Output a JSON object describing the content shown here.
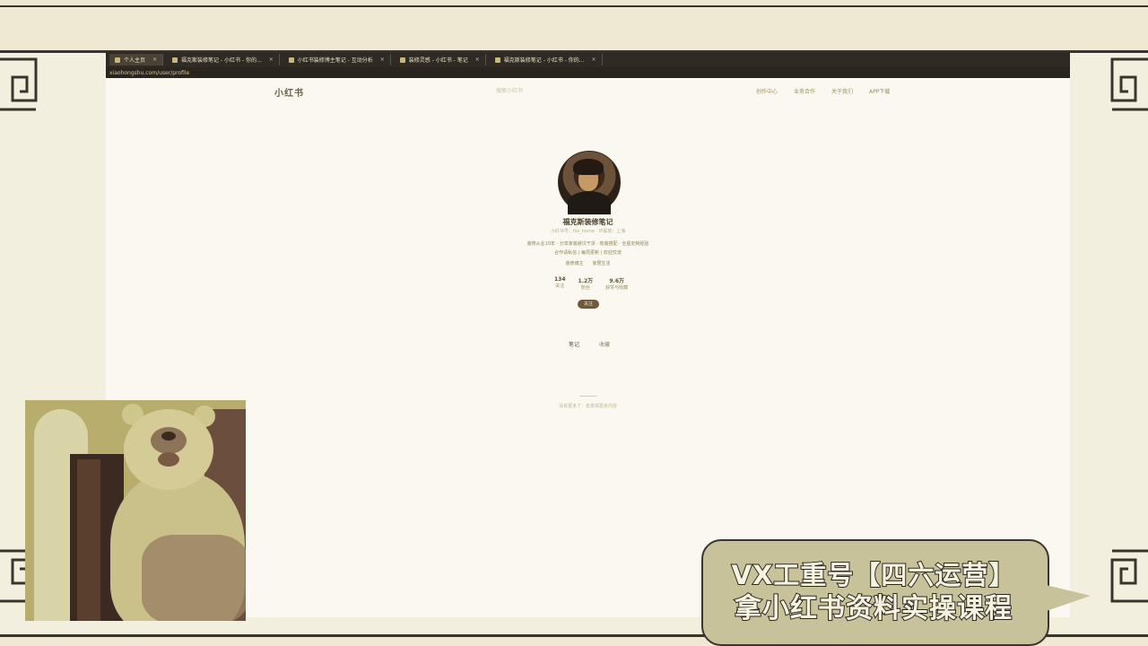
{
  "browser": {
    "tabs": [
      {
        "label": "个人主页",
        "active": true
      },
      {
        "label": "福克斯装修笔记 - 小红书 - 你的..."
      },
      {
        "label": "小红书装修博主笔记 - 互动分析"
      },
      {
        "label": "装修灵感 - 小红书 - 笔记"
      },
      {
        "label": "福克斯装修笔记 - 小红书 - 你的..."
      }
    ],
    "address": "xiaohongshu.com/user/profile"
  },
  "site": {
    "logo": "小红书",
    "search_placeholder": "搜索小红书",
    "nav": [
      "创作中心",
      "业务合作",
      "关于我们",
      "APP下载"
    ]
  },
  "profile": {
    "username": "福克斯装修笔记",
    "user_id": "小红书号：fox_home · IP属地：上海",
    "bio_line1": "装修从业10年 · 分享家装避坑干货 · 软装搭配 · 全屋定制经验",
    "bio_line2": "合作请私信 | 每周更新 | 欢迎交流",
    "tags": [
      "装修博主",
      "家居生活"
    ],
    "stats": [
      {
        "num": "134",
        "label": "关注"
      },
      {
        "num": "1.2万",
        "label": "粉丝"
      },
      {
        "num": "9.6万",
        "label": "获赞与收藏"
      }
    ],
    "follow_label": "关注",
    "tabs": [
      "笔记",
      "收藏"
    ],
    "footer": "没有更多了 · 去发现更多内容"
  },
  "promo": {
    "line1": "VX工重号【四六运营】",
    "line2": "拿小红书资料实操课程"
  },
  "colors": {
    "frame": "#3a352c",
    "page_bg": "#fbf8f1",
    "accent": "#6d5a3a",
    "promo_bg": "#c8c29a"
  }
}
